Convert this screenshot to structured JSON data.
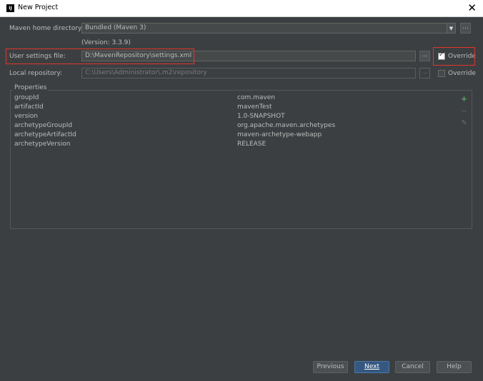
{
  "window": {
    "title": "New Project",
    "app_icon_text": "IJ"
  },
  "form": {
    "maven_home": {
      "label": "Maven home directory:",
      "value": "Bundled (Maven 3)",
      "version_note": "(Version: 3.3.9)"
    },
    "user_settings": {
      "label": "User settings file:",
      "value": "D:\\MavenRepository\\settings.xml",
      "override_label": "Override",
      "override_checked": true
    },
    "local_repo": {
      "label": "Local repository:",
      "value": "C:\\Users\\Administrator\\.m2\\repository",
      "override_label": "Override",
      "override_checked": false
    },
    "browse_label": "..."
  },
  "properties": {
    "title": "Properties",
    "rows": [
      {
        "key": "groupId",
        "value": "com.maven"
      },
      {
        "key": "artifactId",
        "value": "mavenTest"
      },
      {
        "key": "version",
        "value": "1.0-SNAPSHOT"
      },
      {
        "key": "archetypeGroupId",
        "value": "org.apache.maven.archetypes"
      },
      {
        "key": "archetypeArtifactId",
        "value": "maven-archetype-webapp"
      },
      {
        "key": "archetypeVersion",
        "value": "RELEASE"
      }
    ],
    "toolbar": {
      "add_icon": "plus-icon",
      "remove_icon": "minus-icon",
      "edit_icon": "pencil-icon"
    }
  },
  "buttons": {
    "previous": "Previous",
    "next": "Next",
    "cancel": "Cancel",
    "help": "Help"
  },
  "colors": {
    "background": "#3c3f41",
    "highlight_box": "#e0352b",
    "primary_button": "#365880",
    "add_icon": "#59a869"
  }
}
